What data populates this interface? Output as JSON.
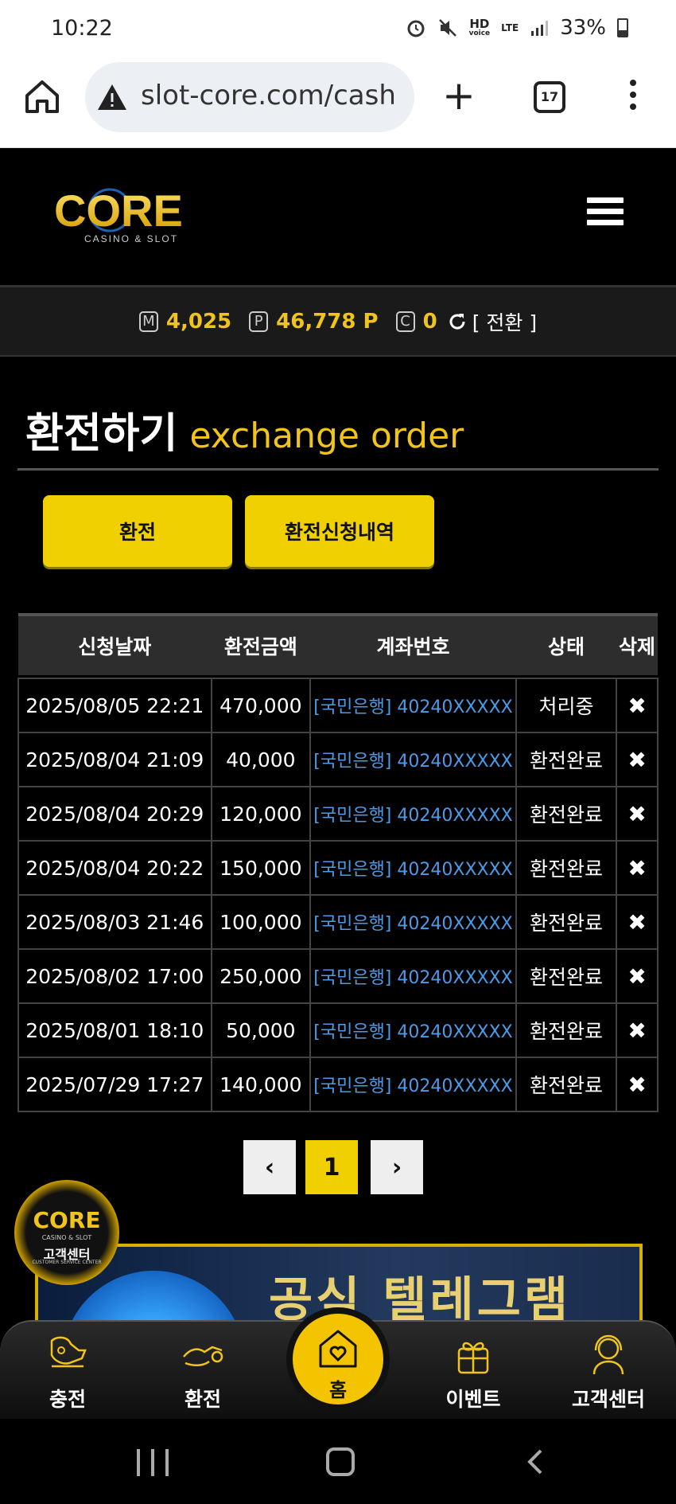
{
  "status_bar": {
    "time": "10:22",
    "hd_label": "HD",
    "voice_label": "voice",
    "lte_label": "LTE",
    "battery": "33%"
  },
  "browser": {
    "url": "slot-core.com/cash",
    "tab_count": "17"
  },
  "site": {
    "logo_text": "CORE",
    "logo_subtext": "CASINO & SLOT"
  },
  "balance": {
    "m_label": "M",
    "m_value": "4,025",
    "p_label": "P",
    "p_value": "46,778 P",
    "c_label": "C",
    "c_value": "0",
    "convert_label": "[ 전환 ]"
  },
  "page": {
    "title_ko": "환전하기",
    "title_en": "exchange order",
    "btn_exchange": "환전",
    "btn_history": "환전신청내역"
  },
  "table": {
    "headers": [
      "신청날짜",
      "환전금액",
      "계좌번호",
      "상태",
      "삭제"
    ],
    "rows": [
      {
        "date": "2025/08/05 22:21",
        "amount": "470,000",
        "account": "[국민은행] 40240XXXXX",
        "status": "처리중",
        "del": "✖"
      },
      {
        "date": "2025/08/04 21:09",
        "amount": "40,000",
        "account": "[국민은행] 40240XXXXX",
        "status": "환전완료",
        "del": "✖"
      },
      {
        "date": "2025/08/04 20:29",
        "amount": "120,000",
        "account": "[국민은행] 40240XXXXX",
        "status": "환전완료",
        "del": "✖"
      },
      {
        "date": "2025/08/04 20:22",
        "amount": "150,000",
        "account": "[국민은행] 40240XXXXX",
        "status": "환전완료",
        "del": "✖"
      },
      {
        "date": "2025/08/03 21:46",
        "amount": "100,000",
        "account": "[국민은행] 40240XXXXX",
        "status": "환전완료",
        "del": "✖"
      },
      {
        "date": "2025/08/02 17:00",
        "amount": "250,000",
        "account": "[국민은행] 40240XXXXX",
        "status": "환전완료",
        "del": "✖"
      },
      {
        "date": "2025/08/01 18:10",
        "amount": "50,000",
        "account": "[국민은행] 40240XXXXX",
        "status": "환전완료",
        "del": "✖"
      },
      {
        "date": "2025/07/29 17:27",
        "amount": "140,000",
        "account": "[국민은행] 40240XXXXX",
        "status": "환전완료",
        "del": "✖"
      }
    ]
  },
  "pagination": {
    "prev": "‹",
    "current": "1",
    "next": "›"
  },
  "cs_badge": {
    "logo": "CORE",
    "sub": "CASINO & SLOT",
    "label": "고객센터",
    "tagline": "CUSTOMER SERVICE CENTER"
  },
  "banner": {
    "text": "공식 텔레그램"
  },
  "bottom_nav": {
    "charge": "충전",
    "exchange": "환전",
    "home": "홈",
    "event": "이벤트",
    "support": "고객센터"
  },
  "colors": {
    "accent": "#f0c419",
    "button": "#f0d000",
    "link": "#4d9be6"
  },
  "icons": [
    "home-icon",
    "warning-icon",
    "plus-icon",
    "tabs-icon",
    "more-icon",
    "menu-icon",
    "refresh-icon",
    "close-icon",
    "chevron-left-icon",
    "chevron-right-icon",
    "charge-icon",
    "exchange-icon",
    "heart-home-icon",
    "gift-icon",
    "support-icon"
  ]
}
